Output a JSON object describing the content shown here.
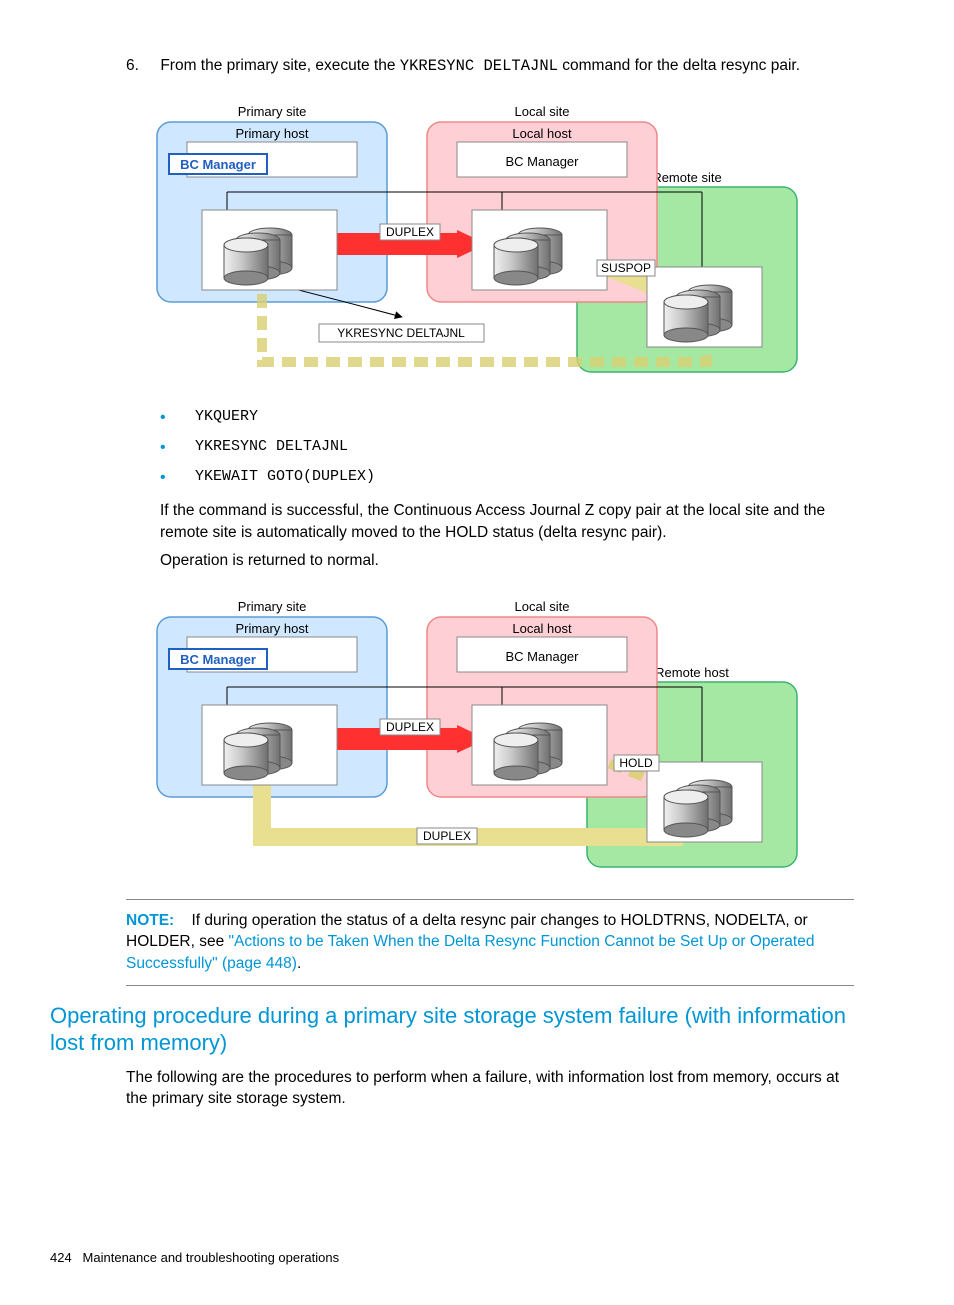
{
  "step": {
    "number": "6.",
    "text_pre": "From the primary site, execute the ",
    "cmd": "YKRESYNC DELTAJNL",
    "text_post": " command for the delta resync pair."
  },
  "diagram1": {
    "primary_site": "Primary site",
    "primary_host": "Primary host",
    "bc_manager1": "BC Manager",
    "local_site": "Local site",
    "local_host": "Local host",
    "bc_manager2": "BC Manager",
    "remote_site": "Remote site",
    "duplex": "DUPLEX",
    "suspop": "SUSPOP",
    "ykresync": "YKRESYNC DELTAJNL"
  },
  "bullets": [
    "YKQUERY",
    "YKRESYNC DELTAJNL",
    "YKEWAIT GOTO(DUPLEX)"
  ],
  "para1": "If the command is successful, the Continuous Access Journal Z copy pair at the local site and the remote site is automatically moved to the HOLD status (delta resync pair).",
  "para2": "Operation is returned to normal.",
  "diagram2": {
    "primary_site": "Primary site",
    "primary_host": "Primary host",
    "bc_manager1": "BC Manager",
    "local_site": "Local site",
    "local_host": "Local host",
    "bc_manager2": "BC Manager",
    "remote_host": "Remote host",
    "duplex1": "DUPLEX",
    "hold": "HOLD",
    "duplex2": "DUPLEX"
  },
  "note": {
    "label": "NOTE:",
    "text_pre": "If during operation the status of a delta resync pair changes to HOLDTRNS, NODELTA, or HOLDER, see ",
    "link": "\"Actions to be Taken When the Delta Resync Function Cannot be Set Up or Operated Successfully\" (page 448)",
    "text_post": "."
  },
  "heading": "Operating procedure during a primary site storage system failure (with information lost from memory)",
  "para3": "The following are the procedures to perform when a failure, with information lost from memory, occurs at the primary site storage system.",
  "footer": {
    "page": "424",
    "title": "Maintenance and troubleshooting operations"
  }
}
